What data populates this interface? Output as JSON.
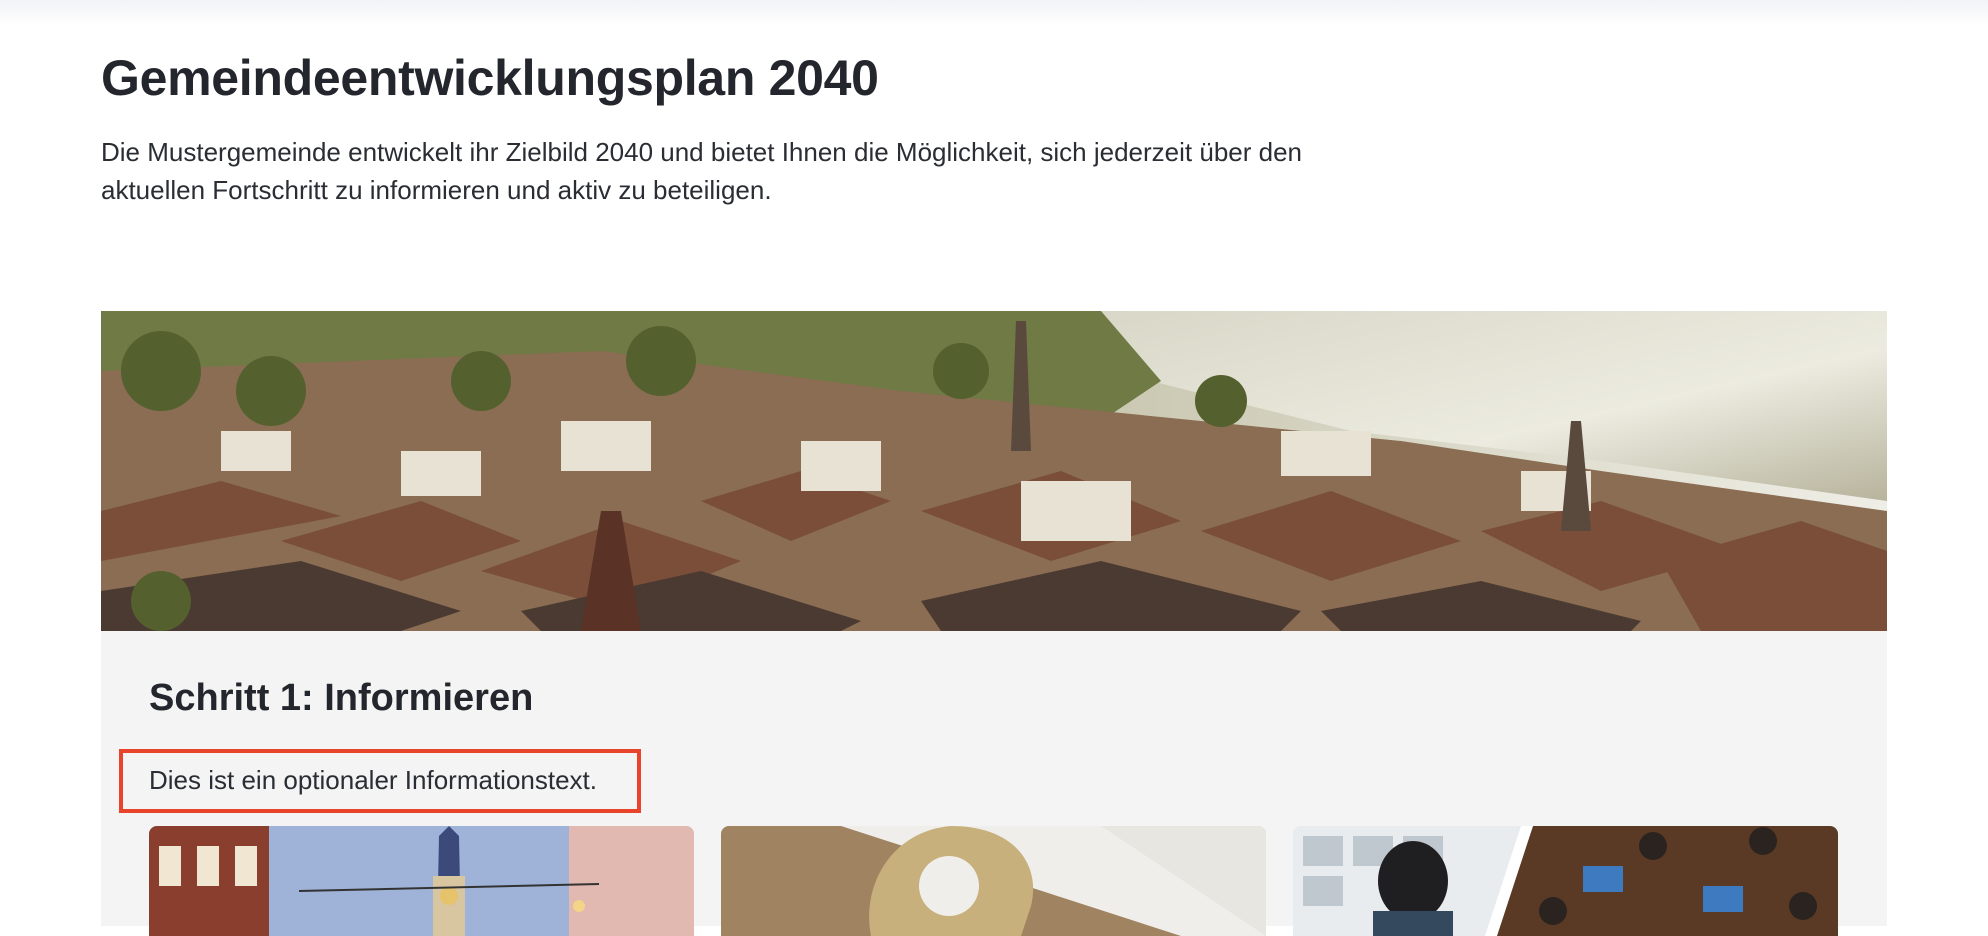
{
  "page": {
    "title": "Gemeindeentwicklungsplan 2040",
    "intro": "Die Mustergemeinde entwickelt ihr Zielbild 2040 und bietet Ihnen die Möglichkeit, sich jederzeit über den aktuellen Fortschritt zu informieren und aktiv zu beteiligen."
  },
  "hero": {
    "image": "town-panorama-lake"
  },
  "step": {
    "title": "Schritt 1: Informieren",
    "text": "Dies ist ein optionaler Informationstext.",
    "highlight_color": "#e8432b",
    "cards": [
      {
        "image": "old-town-street-clocktower"
      },
      {
        "image": "paper-location-pin"
      },
      {
        "image": "people-working-at-table"
      }
    ]
  }
}
